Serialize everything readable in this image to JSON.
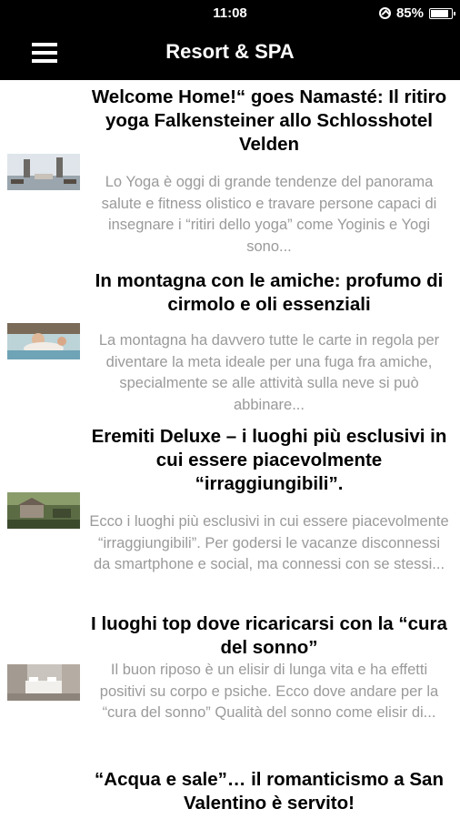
{
  "status_bar": {
    "time": "11:08",
    "battery_percent": "85%"
  },
  "header": {
    "title": "Resort & SPA"
  },
  "articles": [
    {
      "title": "Welcome Home!“ goes Namasté: Il ritiro yoga Falkensteiner allo Schlosshotel Velden",
      "summary": "Lo Yoga è oggi di grande tendenze del panorama salute e fitness olistico e travare persone capaci di insegnare i “ritiri dello yoga” come Yoginis e Yogi sono..."
    },
    {
      "title": "In montagna con le amiche: profumo di cirmolo e oli essenziali",
      "summary": "La montagna ha davvero tutte le carte in regola per diventare la meta ideale per una fuga fra amiche, specialmente se alle attività sulla neve si può abbinare..."
    },
    {
      "title": "Eremiti Deluxe – i luoghi più esclusivi in cui essere piacevolmente “irraggiungibili”.",
      "summary": "Ecco i luoghi più esclusivi in cui essere piacevolmente “irraggiungibili”. Per godersi le vacanze disconnessi da smartphone e social, ma connessi con se stessi..."
    },
    {
      "title": "I luoghi top dove ricaricarsi con la “cura del sonno”",
      "summary": "Il buon riposo è un elisir di lunga vita e ha effetti positivi su corpo e psiche. Ecco dove andare per la “cura del sonno” Qualità del sonno come elisir di..."
    },
    {
      "title": "“Acqua e sale”… il romanticismo a San Valentino è servito!",
      "summary": ""
    }
  ]
}
